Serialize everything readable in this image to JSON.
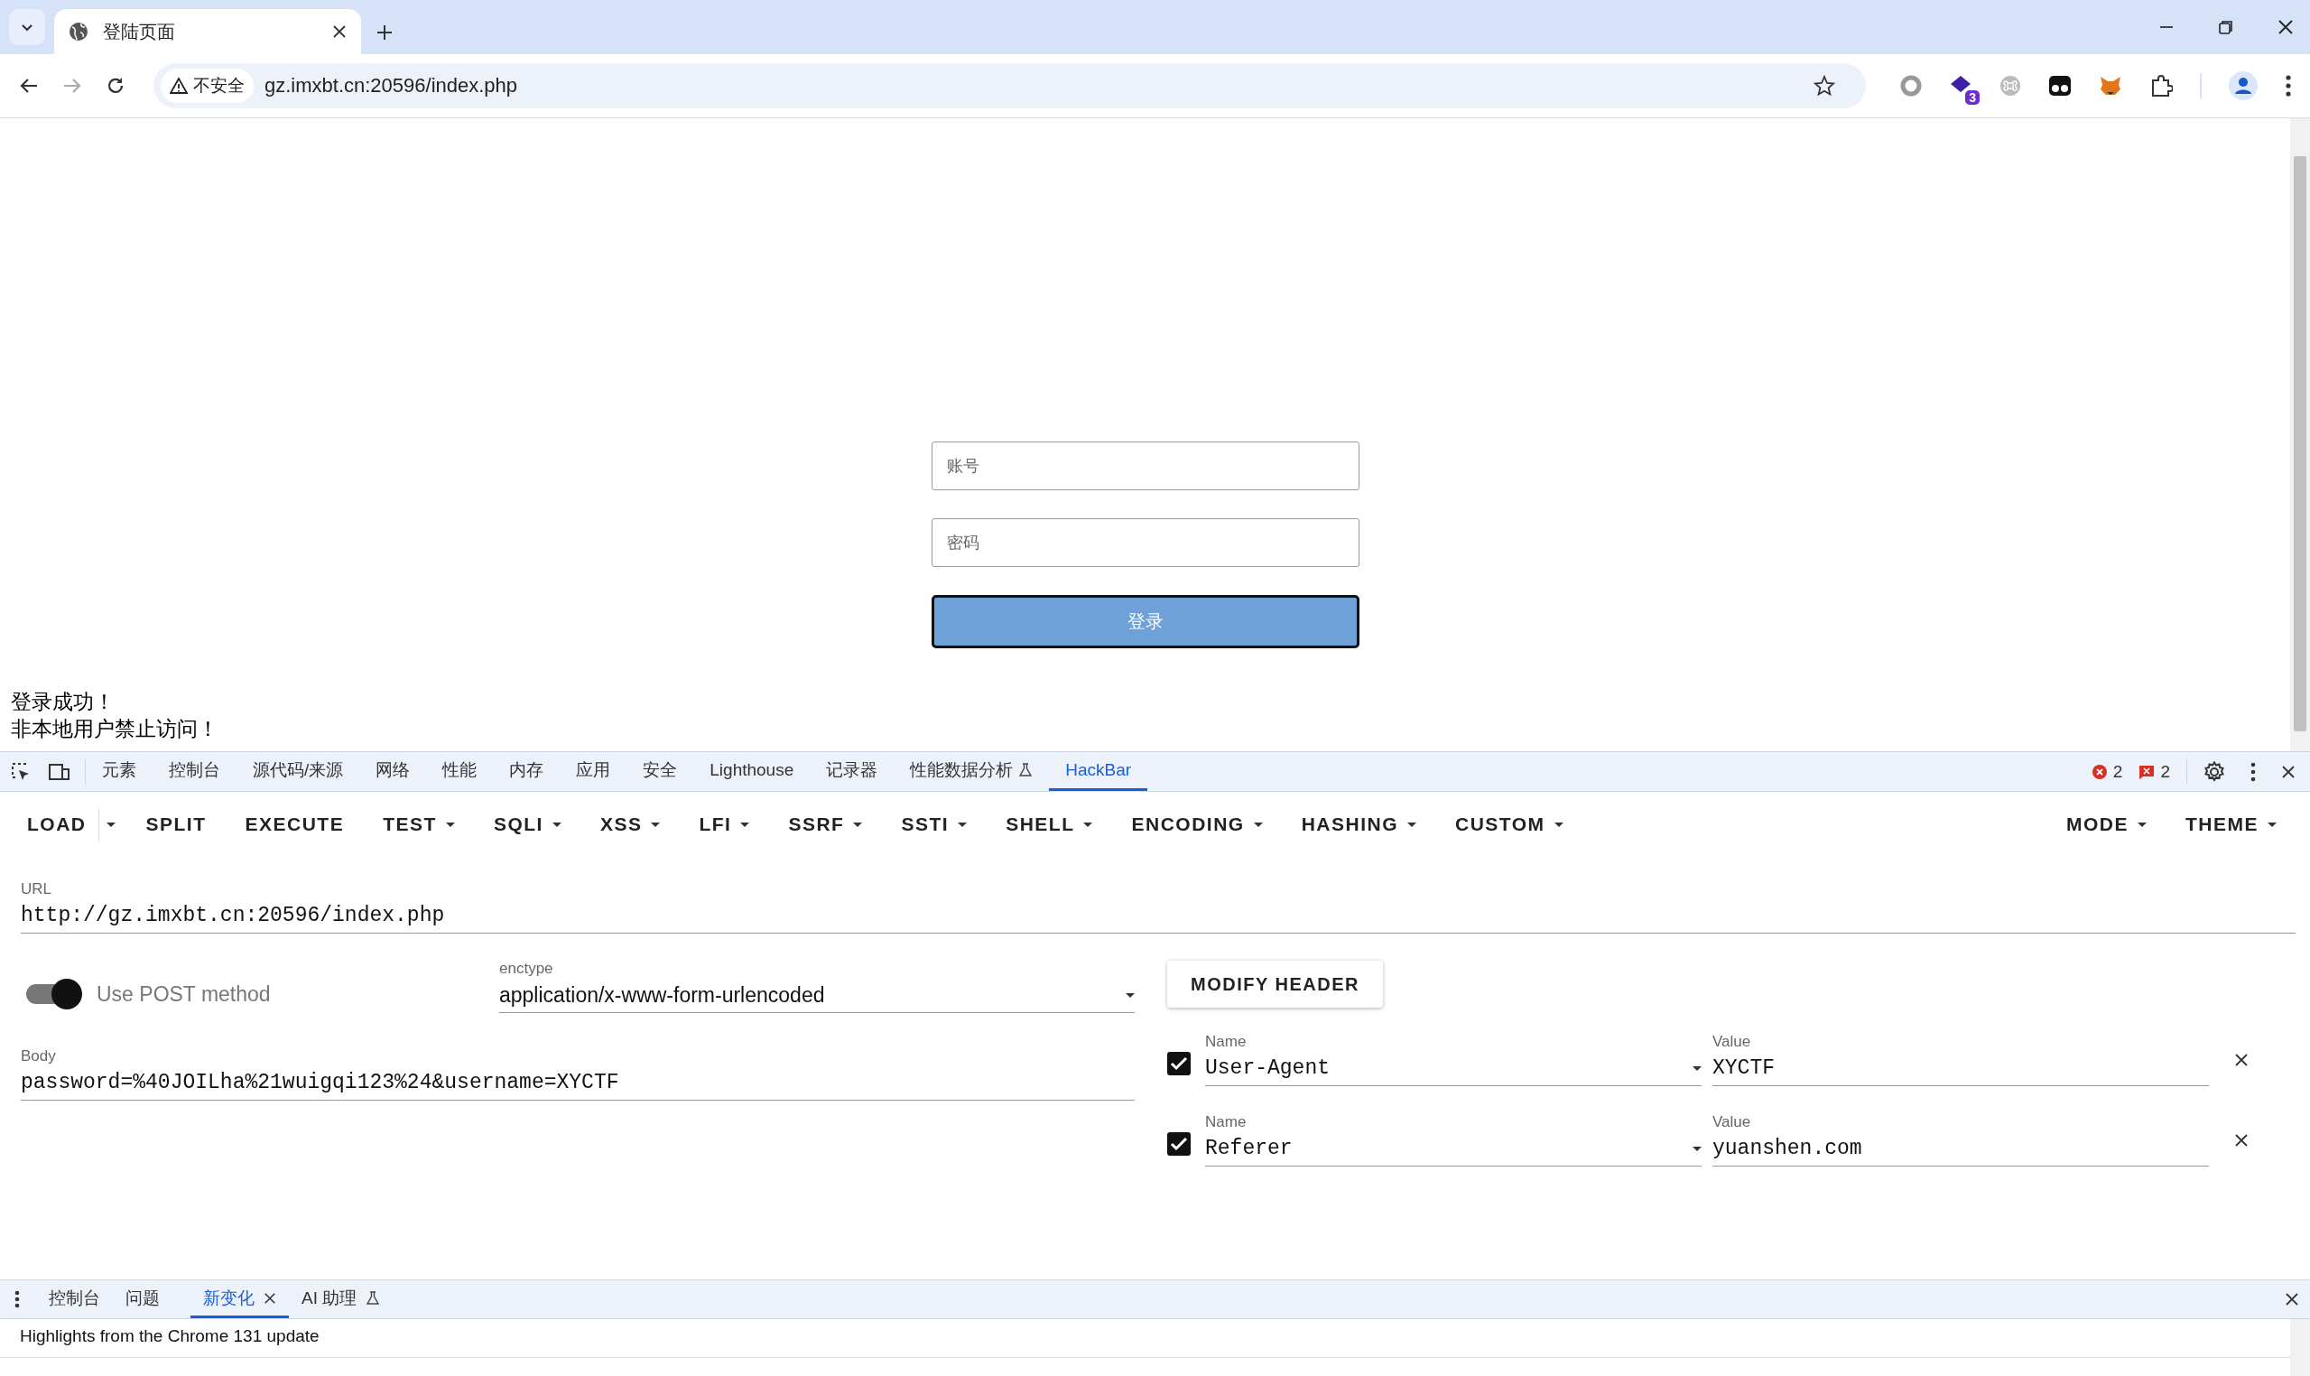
{
  "browser": {
    "tabs": [
      {
        "title": "登陆页面",
        "selected": true
      }
    ],
    "address": {
      "security": "不安全",
      "url": "gz.imxbt.cn:20596/index.php"
    },
    "extension_badge": "3"
  },
  "page": {
    "username_placeholder": "账号",
    "password_placeholder": "密码",
    "login_button": "登录",
    "messages": [
      "登录成功！",
      "非本地用户禁止访问！"
    ]
  },
  "devtools": {
    "tabs": [
      {
        "label": "元素",
        "selected": false,
        "experimental": false
      },
      {
        "label": "控制台",
        "selected": false,
        "experimental": false
      },
      {
        "label": "源代码/来源",
        "selected": false,
        "experimental": false
      },
      {
        "label": "网络",
        "selected": false,
        "experimental": false
      },
      {
        "label": "性能",
        "selected": false,
        "experimental": false
      },
      {
        "label": "内存",
        "selected": false,
        "experimental": false
      },
      {
        "label": "应用",
        "selected": false,
        "experimental": false
      },
      {
        "label": "安全",
        "selected": false,
        "experimental": false
      },
      {
        "label": "Lighthouse",
        "selected": false,
        "experimental": false
      },
      {
        "label": "记录器",
        "selected": false,
        "experimental": false
      },
      {
        "label": "性能数据分析",
        "selected": false,
        "experimental": true
      },
      {
        "label": "HackBar",
        "selected": true,
        "experimental": false
      }
    ],
    "errors": "2",
    "warnings": "2"
  },
  "hackbar": {
    "menu": [
      {
        "label": "LOAD",
        "kind": "split"
      },
      {
        "label": "SPLIT",
        "kind": "button"
      },
      {
        "label": "EXECUTE",
        "kind": "button"
      },
      {
        "label": "TEST",
        "kind": "dropdown"
      },
      {
        "label": "SQLI",
        "kind": "dropdown"
      },
      {
        "label": "XSS",
        "kind": "dropdown"
      },
      {
        "label": "LFI",
        "kind": "dropdown"
      },
      {
        "label": "SSRF",
        "kind": "dropdown"
      },
      {
        "label": "SSTI",
        "kind": "dropdown"
      },
      {
        "label": "SHELL",
        "kind": "dropdown"
      },
      {
        "label": "ENCODING",
        "kind": "dropdown"
      },
      {
        "label": "HASHING",
        "kind": "dropdown"
      },
      {
        "label": "CUSTOM",
        "kind": "dropdown"
      }
    ],
    "right_menu": [
      {
        "label": "MODE",
        "kind": "dropdown"
      },
      {
        "label": "THEME",
        "kind": "dropdown"
      }
    ],
    "url": {
      "label": "URL",
      "value": "http://gz.imxbt.cn:20596/index.php"
    },
    "post": {
      "label": "Use POST method",
      "on": true
    },
    "enctype": {
      "label": "enctype",
      "value": "application/x-www-form-urlencoded"
    },
    "modify_header": "MODIFY HEADER",
    "body": {
      "label": "Body",
      "value": "password=%40JOILha%21wuigqi123%24&username=XYCTF"
    },
    "headers": [
      {
        "checked": true,
        "name_label": "Name",
        "name": "User-Agent",
        "value_label": "Value",
        "value": "XYCTF"
      },
      {
        "checked": true,
        "name_label": "Name",
        "name": "Referer",
        "value_label": "Value",
        "value": "yuanshen.com"
      }
    ]
  },
  "drawer": {
    "tabs": [
      {
        "label": "控制台",
        "selected": false,
        "closable": false,
        "experimental": false
      },
      {
        "label": "问题",
        "selected": false,
        "closable": false,
        "experimental": false
      },
      {
        "label": "新变化",
        "selected": true,
        "closable": true,
        "experimental": false
      },
      {
        "label": "AI 助理",
        "selected": false,
        "closable": false,
        "experimental": true
      }
    ],
    "content": "Highlights from the Chrome 131 update"
  }
}
